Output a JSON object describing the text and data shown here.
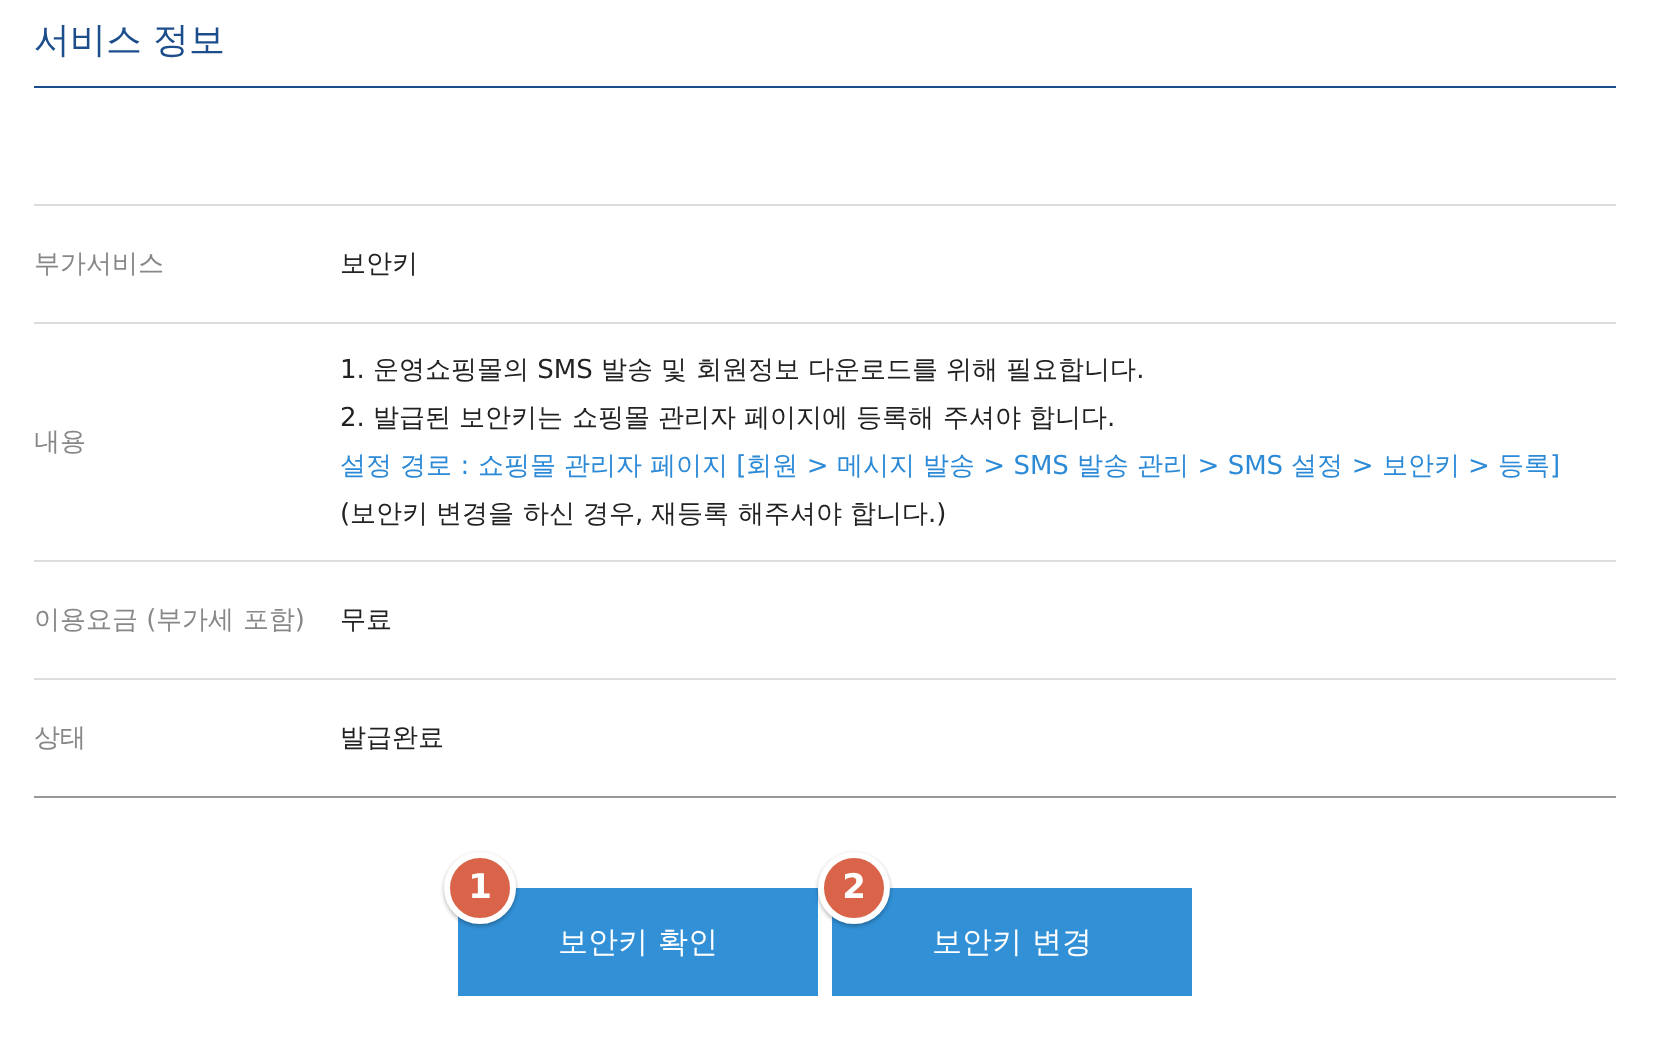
{
  "section_title": "서비스 정보",
  "rows": [
    {
      "label": "부가서비스",
      "lines": [
        {
          "text": "보안키",
          "kind": "plain"
        }
      ]
    },
    {
      "label": "내용",
      "lines": [
        {
          "text": "1. 운영쇼핑몰의 SMS 발송 및 회원정보 다운로드를 위해 필요합니다.",
          "kind": "plain"
        },
        {
          "text": "2. 발급된 보안키는 쇼핑몰 관리자 페이지에 등록해 주셔야 합니다.",
          "kind": "plain"
        },
        {
          "text": "설정 경로 : 쇼핑몰 관리자 페이지 [회원 > 메시지 발송 > SMS 발송 관리 > SMS 설정 > 보안키 > 등록]",
          "kind": "link"
        },
        {
          "text": "(보안키 변경을 하신 경우, 재등록 해주셔야 합니다.)",
          "kind": "plain"
        }
      ]
    },
    {
      "label": "이용요금 (부가세 포함)",
      "lines": [
        {
          "text": "무료",
          "kind": "plain"
        }
      ]
    },
    {
      "label": "상태",
      "lines": [
        {
          "text": "발급완료",
          "kind": "plain"
        }
      ]
    }
  ],
  "buttons": [
    {
      "label": "보안키 확인",
      "badge": "1"
    },
    {
      "label": "보안키 변경",
      "badge": "2"
    }
  ]
}
